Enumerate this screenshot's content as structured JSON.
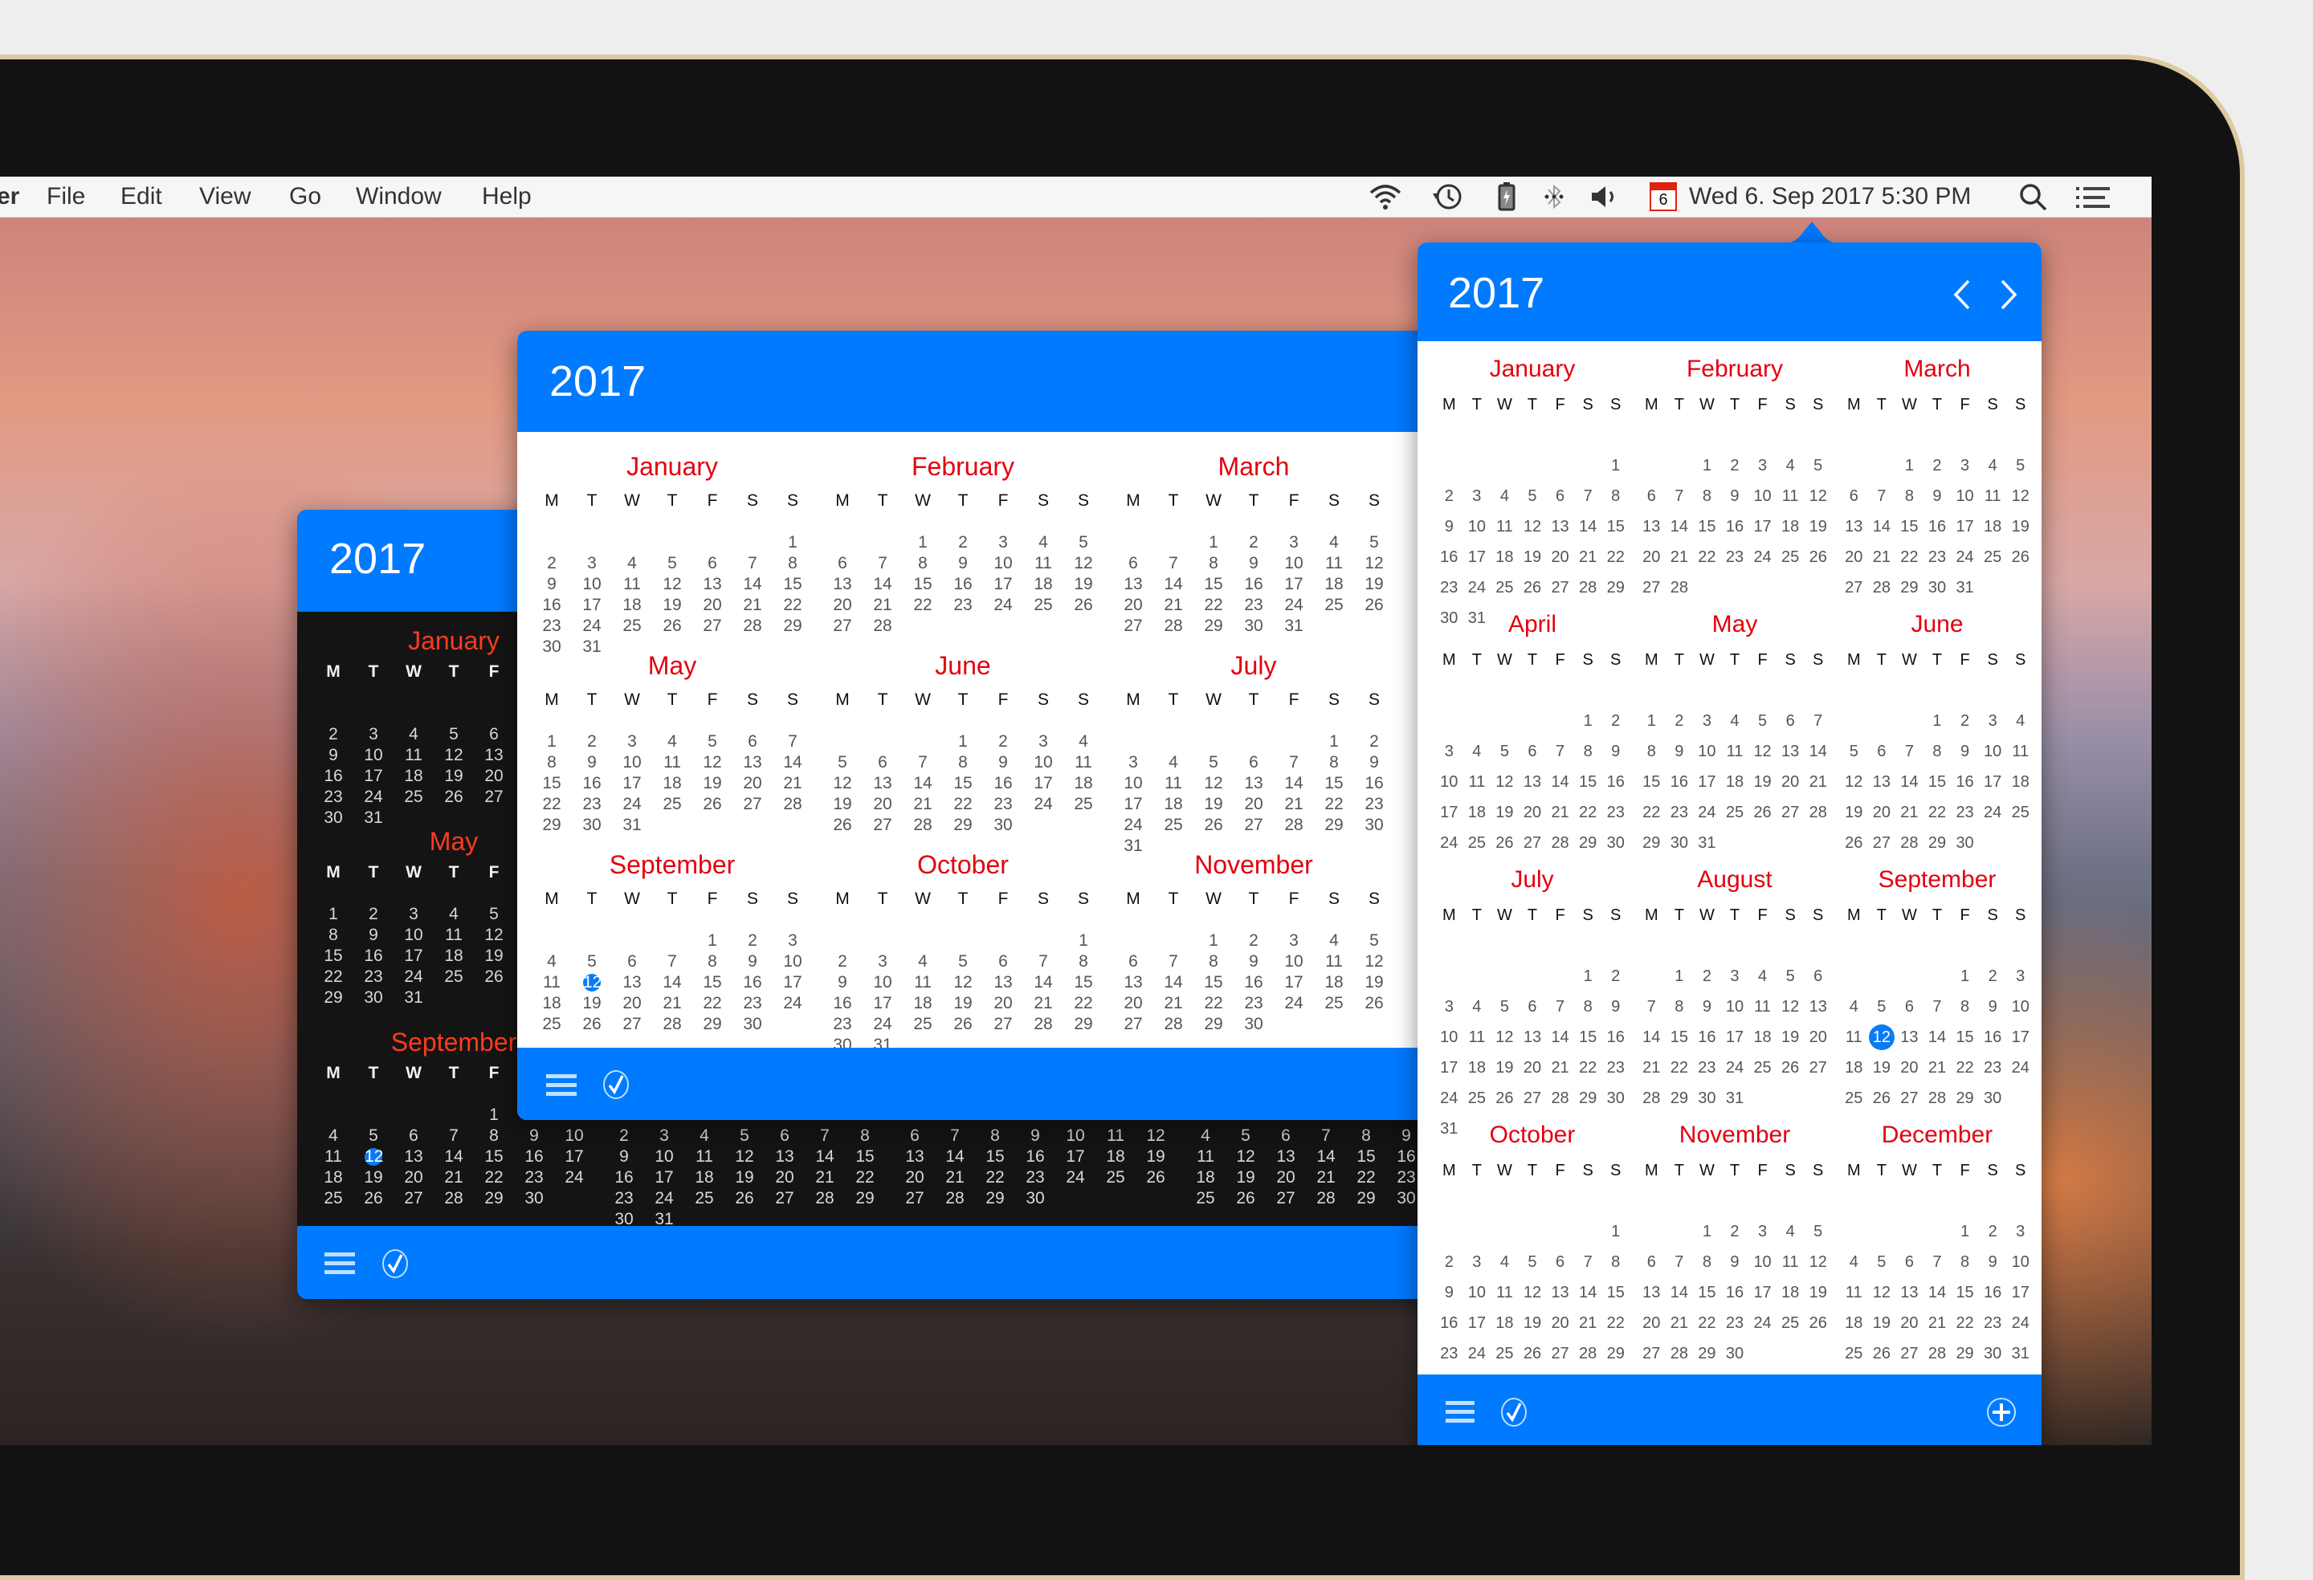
{
  "menubar": {
    "app_fragment": "er",
    "items": [
      "File",
      "Edit",
      "View",
      "Go",
      "Window",
      "Help"
    ],
    "status_icons": [
      "wifi-icon",
      "time-machine-icon",
      "battery-charging-icon",
      "bluetooth-icon",
      "volume-icon",
      "calendar-date-icon"
    ],
    "calendar_icon_day": "6",
    "clock": "Wed 6. Sep 2017 5:30 PM",
    "right_icons": [
      "spotlight-search-icon",
      "notification-center-icon"
    ]
  },
  "colors": {
    "accent": "#007aff",
    "month_name": "#e3000f",
    "month_name_dark": "#ff3b1f",
    "today": "#0a7bf5"
  },
  "weekday_labels": [
    "M",
    "T",
    "W",
    "T",
    "F",
    "S",
    "S"
  ],
  "today": {
    "month": 9,
    "day": 12
  },
  "year": "2017",
  "months": [
    {
      "n": 1,
      "name": "January",
      "first": 6,
      "days": 31
    },
    {
      "n": 2,
      "name": "February",
      "first": 2,
      "days": 28
    },
    {
      "n": 3,
      "name": "March",
      "first": 2,
      "days": 31
    },
    {
      "n": 4,
      "name": "April",
      "first": 5,
      "days": 30
    },
    {
      "n": 5,
      "name": "May",
      "first": 0,
      "days": 31
    },
    {
      "n": 6,
      "name": "June",
      "first": 3,
      "days": 30
    },
    {
      "n": 7,
      "name": "July",
      "first": 5,
      "days": 31
    },
    {
      "n": 8,
      "name": "August",
      "first": 1,
      "days": 31
    },
    {
      "n": 9,
      "name": "September",
      "first": 4,
      "days": 30
    },
    {
      "n": 10,
      "name": "October",
      "first": 6,
      "days": 31
    },
    {
      "n": 11,
      "name": "November",
      "first": 2,
      "days": 30
    },
    {
      "n": 12,
      "name": "December",
      "first": 4,
      "days": 31
    }
  ],
  "windows": {
    "dark": {
      "title": "2017",
      "theme": "dark",
      "visible_months": [
        1,
        2,
        3,
        4,
        5,
        6,
        7,
        8,
        9,
        10,
        11,
        12
      ],
      "footer_icons": [
        "list-icon",
        "checkmark-circle-icon"
      ]
    },
    "light": {
      "title": "2017",
      "theme": "light",
      "visible_months": [
        1,
        2,
        3,
        5,
        6,
        7,
        9,
        10,
        11
      ],
      "footer_icons": [
        "list-icon",
        "checkmark-circle-icon"
      ]
    },
    "popover": {
      "title": "2017",
      "theme": "light",
      "visible_months": [
        1,
        2,
        3,
        4,
        5,
        6,
        7,
        8,
        9,
        10,
        11,
        12
      ],
      "prev_label": "‹",
      "next_label": "›",
      "footer_icons": [
        "list-icon",
        "checkmark-circle-icon",
        "add-event-icon"
      ]
    }
  }
}
